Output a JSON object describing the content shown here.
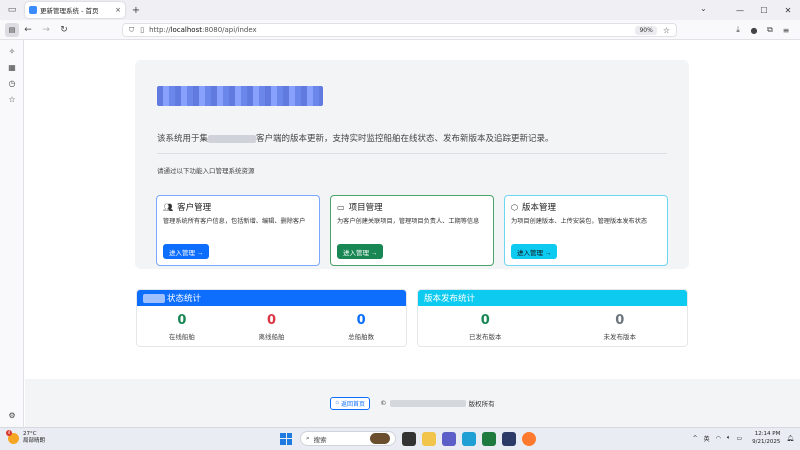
{
  "browser": {
    "tab_title": "更新管理系统 - 首页",
    "tab_close": "×",
    "new_tab": "+",
    "url_prefix": "http://",
    "url_host": "localhost",
    "url_rest": ":8080/api/index",
    "zoom": "90%"
  },
  "hero": {
    "description_prefix": "该系统用于集",
    "description_suffix": "客户端的版本更新，支持实时监控船舶在线状态、发布新版本及追踪更新记录。",
    "hint": "请通过以下功能入口管理系统资源"
  },
  "cards": [
    {
      "title": "客户管理",
      "desc": "管理系统所有客户信息，包括新增、编辑、删除客户",
      "button": "进入管理 →",
      "icon": "users-icon"
    },
    {
      "title": "项目管理",
      "desc": "为客户创建关联项目，管理项目负责人、工期等信息",
      "button": "进入管理 →",
      "icon": "folder-icon"
    },
    {
      "title": "版本管理",
      "desc": "为项目创建版本、上传安装包，管理版本发布状态",
      "button": "进入管理 →",
      "icon": "box-icon"
    }
  ],
  "status_stats": {
    "title": "状态统计",
    "items": [
      {
        "value": "0",
        "label": "在线船舶",
        "color": "#198754"
      },
      {
        "value": "0",
        "label": "离线船舶",
        "color": "#dc3545"
      },
      {
        "value": "0",
        "label": "总船舶数",
        "color": "#0d6efd"
      }
    ]
  },
  "release_stats": {
    "title": "版本发布统计",
    "items": [
      {
        "value": "0",
        "label": "已发布版本",
        "color": "#198754"
      },
      {
        "value": "0",
        "label": "未发布版本",
        "color": "#6c757d"
      }
    ]
  },
  "footer": {
    "home_button": "返回首页",
    "copyright_symbol": "©",
    "rights": "版权所有"
  },
  "taskbar": {
    "weather_temp": "27°C",
    "weather_desc": "局部晴朗",
    "notification_count": "4",
    "search_placeholder": "搜索",
    "ime": "英",
    "time": "12:14 PM",
    "date": "9/21/2025"
  }
}
